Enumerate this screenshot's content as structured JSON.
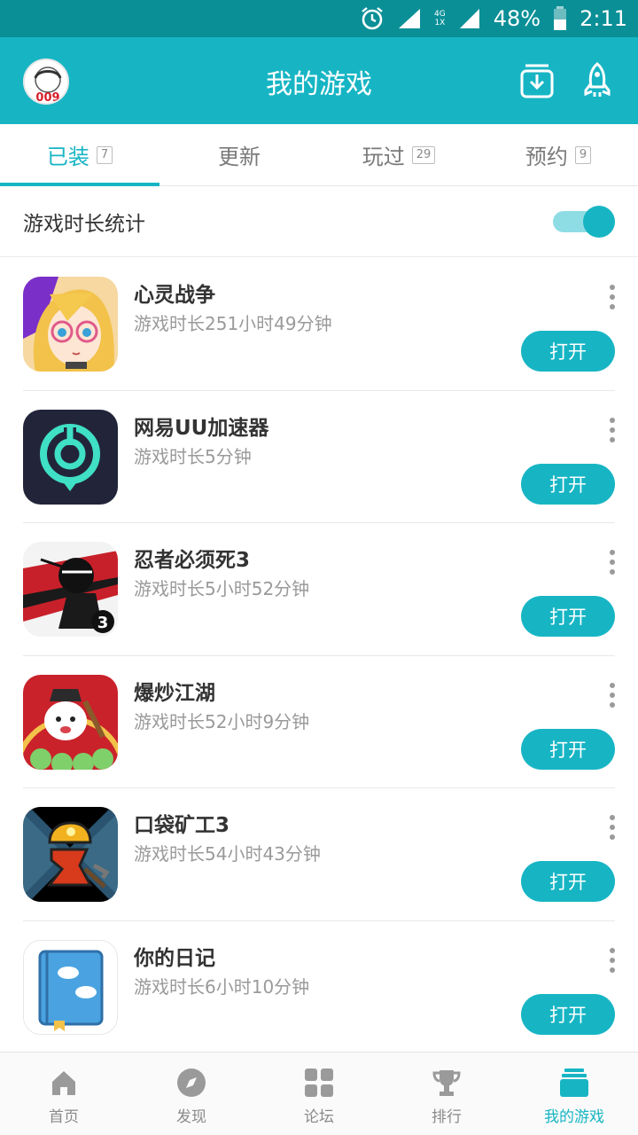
{
  "status_bar": {
    "battery": "48%",
    "time": "2:11",
    "network_top": "4G",
    "network_bottom": "1X"
  },
  "header": {
    "title": "我的游戏",
    "avatar_text": "009"
  },
  "tabs": [
    {
      "label": "已装",
      "badge": "7",
      "active": true
    },
    {
      "label": "更新",
      "badge": "",
      "active": false
    },
    {
      "label": "玩过",
      "badge": "29",
      "active": false
    },
    {
      "label": "预约",
      "badge": "9",
      "active": false
    }
  ],
  "stats": {
    "label": "游戏时长统计",
    "toggle_on": true
  },
  "open_label": "打开",
  "games": [
    {
      "name": "心灵战争",
      "time": "游戏时长251小时49分钟",
      "icon": "anime-girl-icon"
    },
    {
      "name": "网易UU加速器",
      "time": "游戏时长5分钟",
      "icon": "uu-accelerator-icon"
    },
    {
      "name": "忍者必须死3",
      "time": "游戏时长5小时52分钟",
      "icon": "ninja-icon"
    },
    {
      "name": "爆炒江湖",
      "time": "游戏时长52小时9分钟",
      "icon": "chef-icon"
    },
    {
      "name": "口袋矿工3",
      "time": "游戏时长54小时43分钟",
      "icon": "miner-icon"
    },
    {
      "name": "你的日记",
      "time": "游戏时长6小时10分钟",
      "icon": "diary-book-icon"
    }
  ],
  "bottom_nav": [
    {
      "label": "首页",
      "icon": "home-icon",
      "active": false
    },
    {
      "label": "发现",
      "icon": "compass-icon",
      "active": false
    },
    {
      "label": "论坛",
      "icon": "grid-icon",
      "active": false
    },
    {
      "label": "排行",
      "icon": "trophy-icon",
      "active": false
    },
    {
      "label": "我的游戏",
      "icon": "my-games-icon",
      "active": true
    }
  ],
  "colors": {
    "accent": "#17b5c4",
    "status_bar": "#0a8f97"
  }
}
